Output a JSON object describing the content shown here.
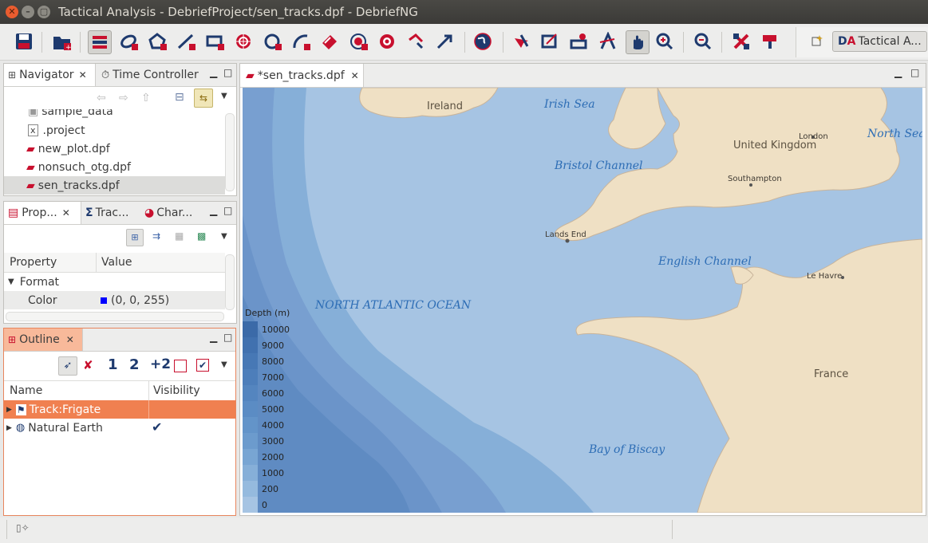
{
  "window": {
    "title": "Tactical Analysis - DebriefProject/sen_tracks.dpf - DebriefNG"
  },
  "toolbar": {
    "icons": [
      "save-icon",
      "open-icon",
      "layers-icon",
      "ellipse-icon",
      "polygon-icon",
      "line-icon",
      "rectangle-icon",
      "range-rings-icon",
      "circle-icon",
      "arc-icon",
      "label-icon",
      "target-icon",
      "bullseye-icon",
      "vector-icon",
      "arrow-icon",
      "globe-icon",
      "select-icon",
      "zoom-box-icon",
      "snail-icon",
      "measure-icon",
      "pan-icon",
      "zoom-in-icon",
      "zoom-out-icon",
      "fit-icon",
      "paint-icon"
    ],
    "perspective_label": "Tactical A..."
  },
  "navigator": {
    "tabs": [
      {
        "label": "Navigator"
      },
      {
        "label": "Time Controller"
      }
    ],
    "files": [
      {
        "label": "sample_data"
      },
      {
        "label": ".project"
      },
      {
        "label": "new_plot.dpf"
      },
      {
        "label": "nonsuch_otg.dpf"
      },
      {
        "label": "sen_tracks.dpf"
      }
    ]
  },
  "properties": {
    "tabs": [
      {
        "label": "Prop..."
      },
      {
        "label": "Trac..."
      },
      {
        "label": "Char..."
      }
    ],
    "columns": [
      "Property",
      "Value"
    ],
    "rows": [
      {
        "property": "Format",
        "value": ""
      },
      {
        "property": "Color",
        "value": "(0, 0, 255)",
        "swatch": "#0000ff"
      }
    ]
  },
  "outline": {
    "tab_label": "Outline",
    "toolbar_numbers": [
      "1",
      "2",
      "+2"
    ],
    "columns": [
      "Name",
      "Visibility"
    ],
    "rows": [
      {
        "name": "Track:Frigate",
        "visible": false,
        "selected": true
      },
      {
        "name": "Natural Earth",
        "visible": true,
        "selected": false
      }
    ]
  },
  "editor": {
    "tab_label": "*sen_tracks.dpf",
    "map": {
      "sea_labels": [
        "Irish Sea",
        "North Sea",
        "Bristol Channel",
        "English Channel",
        "NORTH ATLANTIC OCEAN",
        "Bay of Biscay"
      ],
      "land_labels": [
        "Ireland",
        "United Kingdom",
        "France"
      ],
      "city_labels": [
        "London",
        "Southampton",
        "Lands End",
        "Le Havre"
      ],
      "legend": {
        "title": "Depth (m)",
        "entries": [
          {
            "label": "10000",
            "color": "#3b6aa8"
          },
          {
            "label": "9000",
            "color": "#4171af"
          },
          {
            "label": "8000",
            "color": "#4778b5"
          },
          {
            "label": "7000",
            "color": "#4d7eba"
          },
          {
            "label": "6000",
            "color": "#5485bf"
          },
          {
            "label": "5000",
            "color": "#5b8cc4"
          },
          {
            "label": "4000",
            "color": "#6394c9"
          },
          {
            "label": "3000",
            "color": "#6c9bcd"
          },
          {
            "label": "2000",
            "color": "#78a5d3"
          },
          {
            "label": "1000",
            "color": "#86afd8"
          },
          {
            "label": "200",
            "color": "#95bade"
          },
          {
            "label": "0",
            "color": "#a6c4e3"
          }
        ]
      },
      "colors": {
        "land": "#efe0c4",
        "coast": "#c8b49b",
        "shelf": "#a6c4e3",
        "deep": "#5e8fc6"
      }
    }
  }
}
